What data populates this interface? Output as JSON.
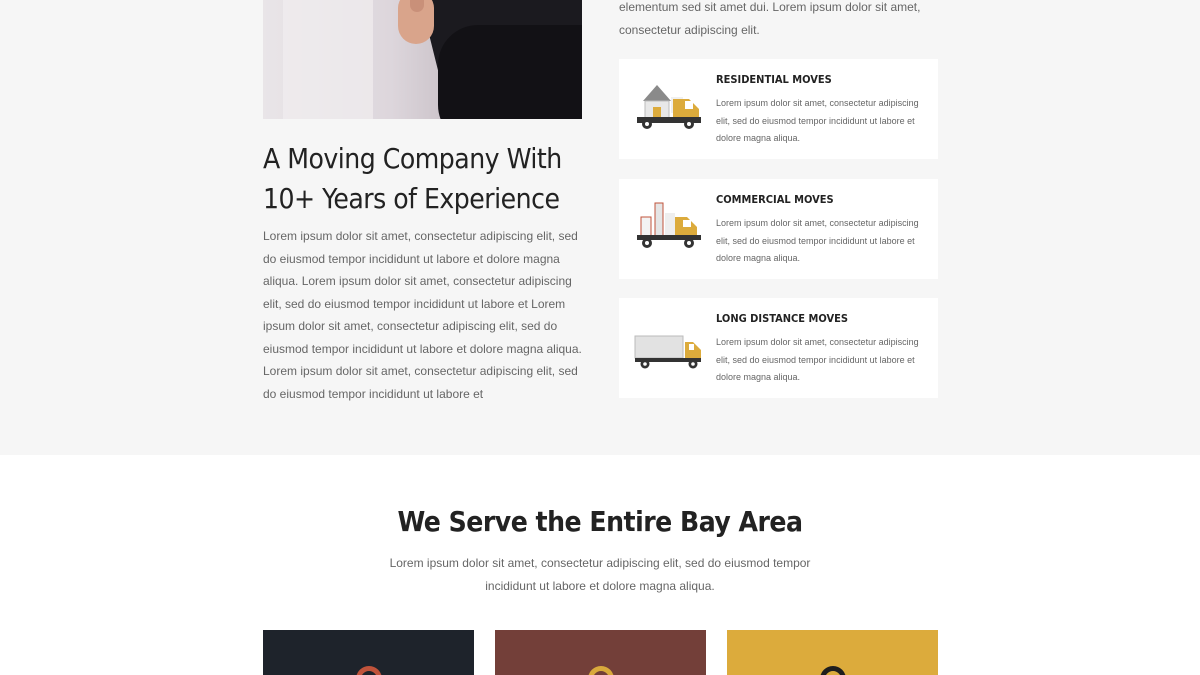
{
  "intro": {
    "text": "elementum sed sit amet dui. Lorem ipsum dolor sit amet, consectetur adipiscing elit."
  },
  "about": {
    "title": "A Moving Company With 10+ Years of Experience",
    "text": "Lorem ipsum dolor sit amet, consectetur adipiscing elit, sed do eiusmod tempor incididunt ut labore et dolore magna aliqua. Lorem ipsum dolor sit amet, consectetur adipiscing elit, sed do eiusmod tempor incididunt ut labore et Lorem ipsum dolor sit amet, consectetur adipiscing elit, sed do eiusmod tempor incididunt ut labore et dolore magna aliqua. Lorem ipsum dolor sit amet, consectetur adipiscing elit, sed do eiusmod tempor incididunt ut labore et"
  },
  "services": [
    {
      "title": "RESIDENTIAL MOVES",
      "text": "Lorem ipsum dolor sit amet, consectetur adipiscing elit, sed do eiusmod tempor incididunt ut labore et dolore magna aliqua.",
      "icon": "house-truck-icon"
    },
    {
      "title": "COMMERCIAL MOVES",
      "text": "Lorem ipsum dolor sit amet, consectetur adipiscing elit, sed do eiusmod tempor incididunt ut labore et dolore magna aliqua.",
      "icon": "cargo-truck-icon"
    },
    {
      "title": "LONG DISTANCE MOVES",
      "text": "Lorem ipsum dolor sit amet, consectetur adipiscing elit, sed do eiusmod tempor incididunt ut labore et dolore magna aliqua.",
      "icon": "semi-truck-icon"
    }
  ],
  "serve": {
    "title": "We Serve the Entire Bay Area",
    "text": "Lorem ipsum dolor sit amet, consectetur adipiscing elit, sed do eiusmod tempor incididunt ut labore et dolore magna aliqua."
  },
  "area_cards": [
    {
      "color": "#1e232b",
      "pin_color": "#c0533b",
      "icon": "location-pin-icon"
    },
    {
      "color": "#733f39",
      "pin_color": "#d9a93c",
      "icon": "location-pin-icon"
    },
    {
      "color": "#dcab3c",
      "pin_color": "#1e1e1e",
      "icon": "location-pin-icon"
    }
  ],
  "colors": {
    "accent": "#dcab3c",
    "section_bg": "#f6f6f6",
    "heading": "#222222"
  }
}
